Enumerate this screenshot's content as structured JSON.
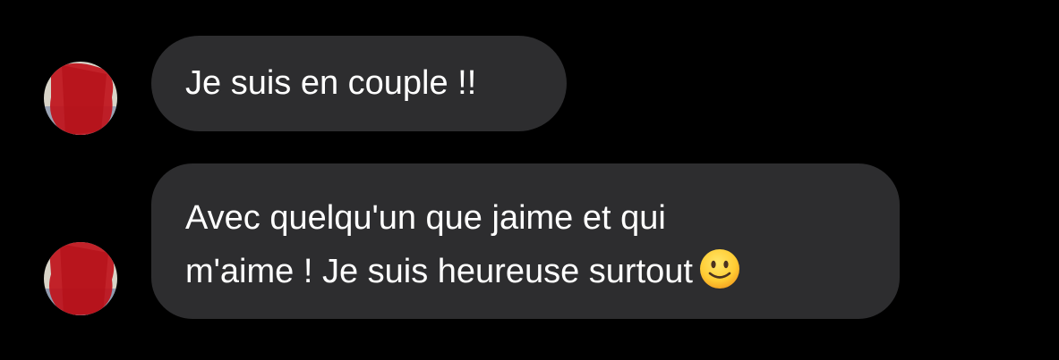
{
  "messages": [
    {
      "text": "Je suis en couple !!"
    },
    {
      "lines": [
        "Avec quelqu'un que jaime et qui",
        "m'aime ! Je suis heureuse surtout"
      ],
      "emoji": "slightly-smiling-face-icon"
    }
  ],
  "colors": {
    "background": "#000000",
    "bubble": "#2d2d2f",
    "text": "#ffffff",
    "redaction": "#c0121b"
  }
}
